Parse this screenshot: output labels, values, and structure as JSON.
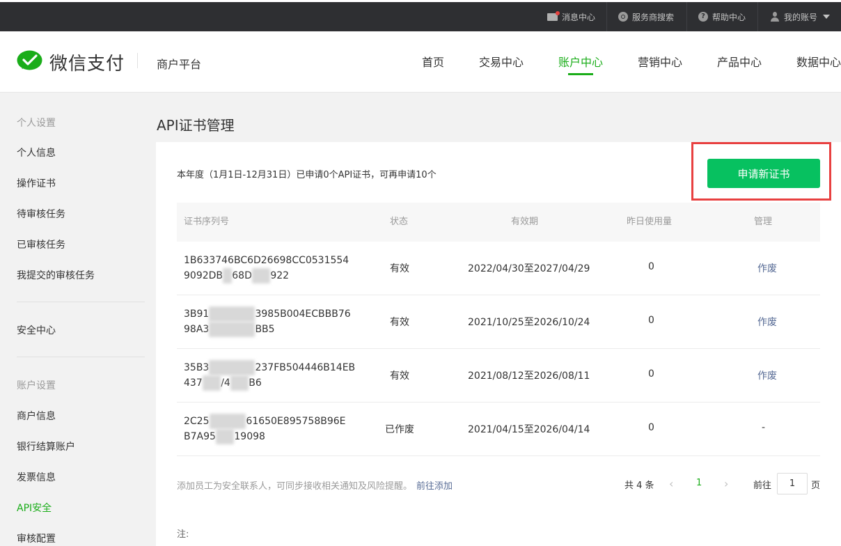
{
  "topbar": {
    "messages": "消息中心",
    "search": "服务商搜索",
    "help": "帮助中心",
    "account": "我的账号"
  },
  "header": {
    "brand": "微信支付",
    "platform": "商户平台",
    "nav": [
      "首页",
      "交易中心",
      "账户中心",
      "营销中心",
      "产品中心",
      "数据中心"
    ],
    "active_nav": "账户中心"
  },
  "sidebar": {
    "group1": "个人设置",
    "items1": [
      "个人信息",
      "操作证书",
      "待审核任务",
      "已审核任务",
      "我提交的审核任务"
    ],
    "security": "安全中心",
    "group2": "账户设置",
    "items2": [
      "商户信息",
      "银行结算账户",
      "发票信息",
      "API安全",
      "审核配置"
    ],
    "active": "API安全"
  },
  "main": {
    "title": "API证书管理",
    "quota_text": "本年度（1月1日-12月31日）已申请0个API证书，可再申请10个",
    "apply_button": "申请新证书",
    "columns": [
      "证书序列号",
      "状态",
      "有效期",
      "昨日使用量",
      "管理"
    ],
    "rows": [
      {
        "serial_a1": "1B633746BC6D26698CC0531554",
        "serial_b1": "9092DB",
        "serial_b2": "68D",
        "serial_b3": "922",
        "status": "有效",
        "period": "2022/04/30至2027/04/29",
        "usage": "0",
        "action": "作废"
      },
      {
        "serial_a1": "3B91",
        "serial_a2": "3985B004ECBBB76",
        "serial_b1": "98A3",
        "serial_b2": "BB5",
        "status": "有效",
        "period": "2021/10/25至2026/10/24",
        "usage": "0",
        "action": "作废"
      },
      {
        "serial_a1": "35B3",
        "serial_a2": "237FB504446B14EB",
        "serial_b1": "437",
        "serial_b2": "/4",
        "serial_b3": "B6",
        "status": "有效",
        "period": "2021/08/12至2026/08/11",
        "usage": "0",
        "action": "作废"
      },
      {
        "serial_a1": "2C25",
        "serial_a2": "61650E895758B96E",
        "serial_b1": "B7A95",
        "serial_b2": "19098",
        "status": "已作废",
        "period": "2021/04/15至2026/04/14",
        "usage": "0",
        "action": "-"
      }
    ],
    "footer_hint": "添加员工为安全联系人，可同步接收相关通知及风险提醒。",
    "footer_link": "前往添加",
    "note": "注:"
  },
  "pagination": {
    "total": "共 4 条",
    "prev": "‹",
    "current": "1",
    "next": "›",
    "goto": "前往",
    "page_value": "1",
    "page_suffix": "页"
  },
  "colors": {
    "brand_green": "#1aad19",
    "button_green": "#07c160",
    "highlight_red": "#e84040",
    "link_blue": "#576b95"
  },
  "icons": [
    "mail-icon",
    "search-icon",
    "help-icon",
    "user-icon",
    "chevron-down-icon",
    "wechat-pay-logo"
  ]
}
